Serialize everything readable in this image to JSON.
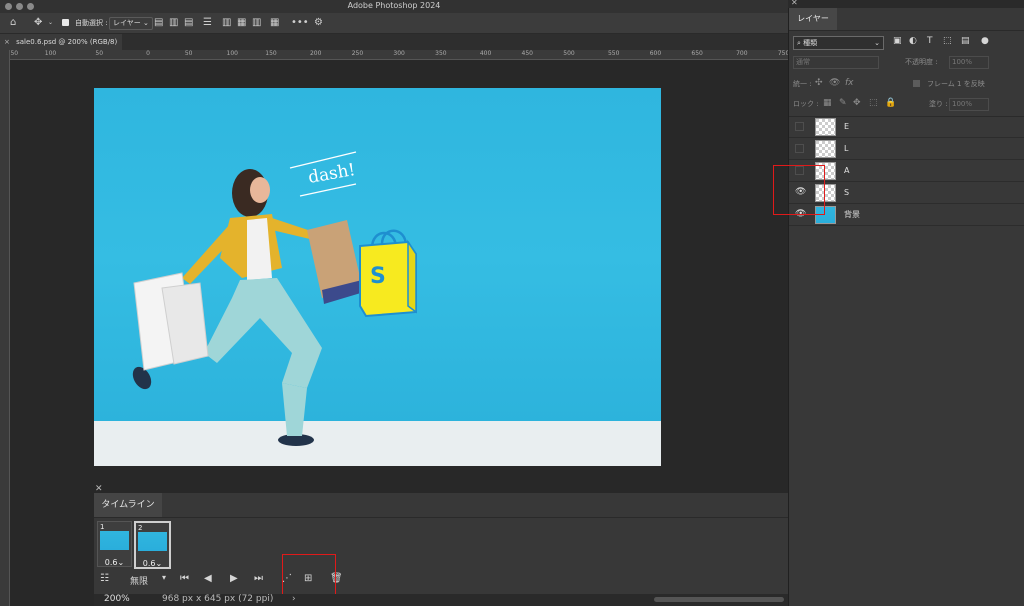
{
  "window": {
    "title": "Adobe Photoshop 2024"
  },
  "options_bar": {
    "auto_select_label": "自動選択 :",
    "auto_select_target": "レイヤー"
  },
  "document_tab": {
    "title": "sale0.6.psd @ 200% (RGB/8) *"
  },
  "ruler_marks": [
    "50",
    "100",
    "50",
    "0",
    "50",
    "100",
    "150",
    "200",
    "250",
    "300",
    "350",
    "400",
    "450",
    "500",
    "550",
    "600",
    "650",
    "700",
    "750"
  ],
  "canvas": {
    "headline": "dash!",
    "bag_letter": "S"
  },
  "timeline": {
    "tab_label": "タイムライン",
    "frames": [
      {
        "number": "1",
        "delay": "0.6",
        "selected": false
      },
      {
        "number": "2",
        "delay": "0.6",
        "selected": true
      }
    ],
    "loop_option": "無限"
  },
  "status": {
    "zoom": "200%",
    "doc_size": "968 px x 645 px (72 ppi)"
  },
  "layers_panel": {
    "tab_label": "レイヤー",
    "filter_kind": "種類",
    "blend_mode": "通常",
    "opacity_label": "不透明度 :",
    "opacity_value": "100%",
    "unify_label": "統一 :",
    "propagate_label": "フレーム 1 を反映",
    "lock_label": "ロック :",
    "fill_label": "塗り :",
    "fill_value": "100%",
    "layers": [
      {
        "name": "E",
        "visible": false
      },
      {
        "name": "L",
        "visible": false
      },
      {
        "name": "A",
        "visible": false
      },
      {
        "name": "S",
        "visible": true
      },
      {
        "name": "背景",
        "visible": true
      }
    ]
  },
  "highlight_color": "#e01a1a"
}
